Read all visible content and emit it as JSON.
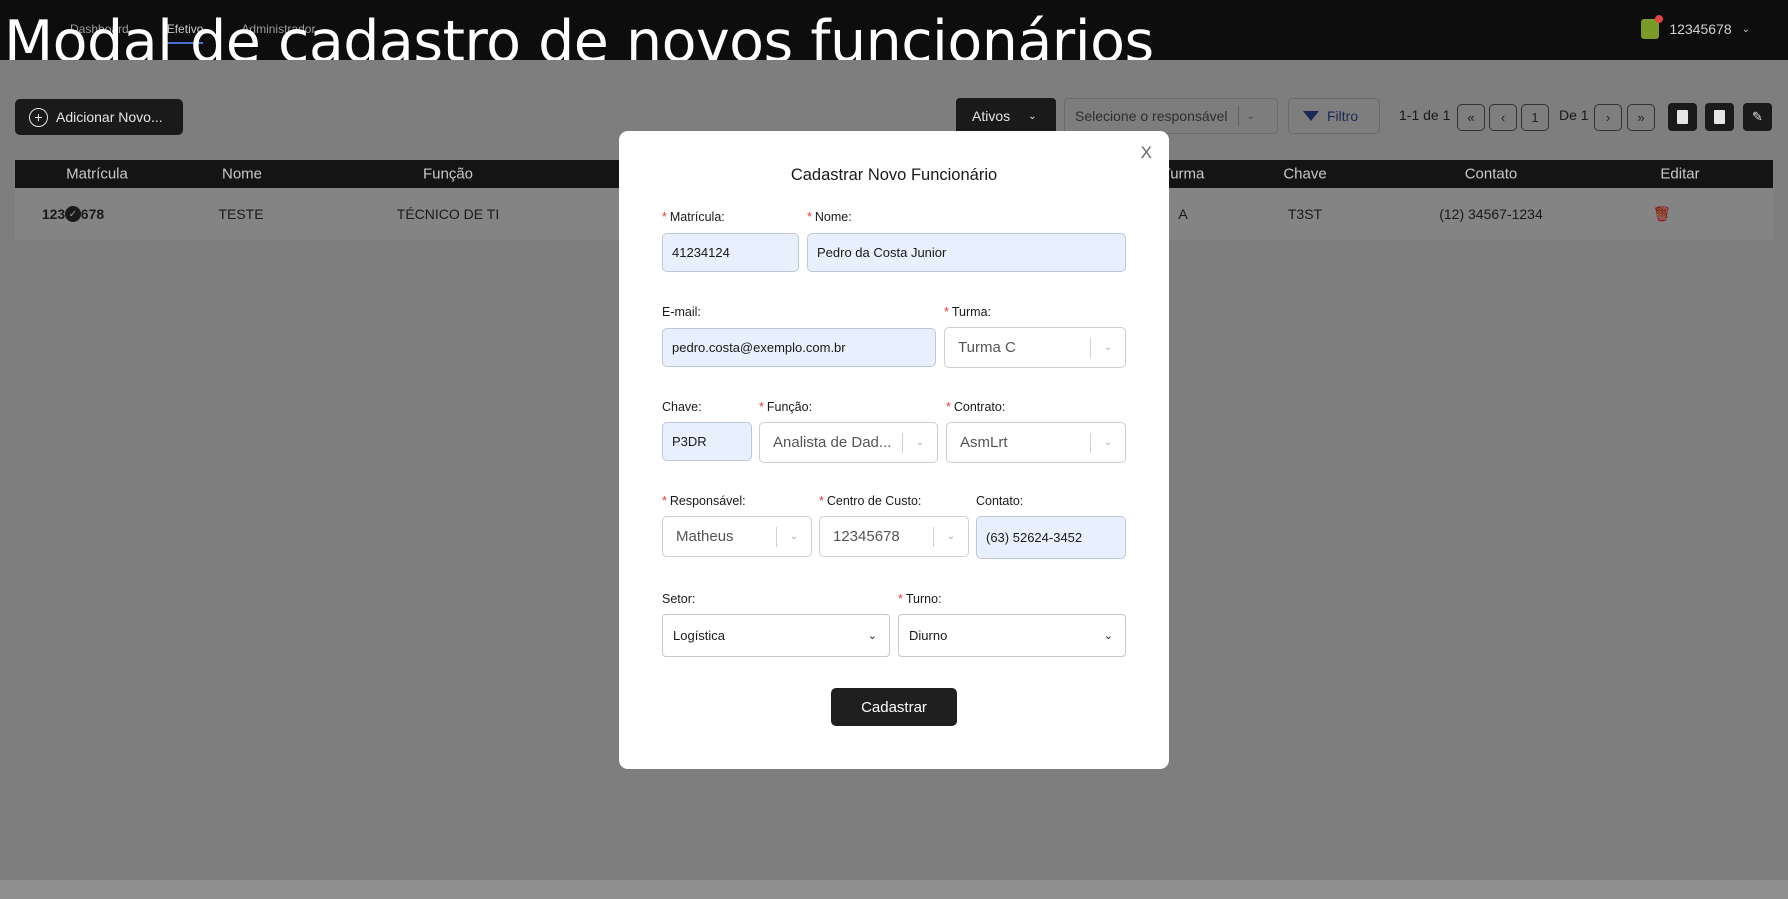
{
  "overlay_title": "Modal de cadastro de novos funcionários",
  "nav": {
    "items": [
      "Dashboard",
      "Efetivo",
      "Administrador"
    ]
  },
  "user": {
    "id": "12345678"
  },
  "toolbar": {
    "add_label": "Adicionar Novo...",
    "status_filter": "Ativos",
    "responsavel_placeholder": "Selecione o responsável",
    "filter_label": "Filtro",
    "range_text": "1-1 de 1",
    "page": "1",
    "page_total": "De 1"
  },
  "table": {
    "headers": {
      "matricula": "Matrícula",
      "nome": "Nome",
      "funcao": "Função",
      "turma": "Turma",
      "chave": "Chave",
      "contato": "Contato",
      "editar": "Editar"
    },
    "row": {
      "matricula": "12345678",
      "nome": "TESTE",
      "funcao": "TÉCNICO DE TI",
      "turma": "A",
      "chave": "T3ST",
      "contato": "(12) 34567-1234"
    }
  },
  "modal": {
    "close": "X",
    "title": "Cadastrar Novo Funcionário",
    "matricula": {
      "label": "Matrícula:",
      "value": "41234124"
    },
    "nome": {
      "label": "Nome:",
      "value": "Pedro da Costa Junior"
    },
    "email": {
      "label": "E-mail:",
      "value": "pedro.costa@exemplo.com.br"
    },
    "turma": {
      "label": "Turma:",
      "value": "Turma C"
    },
    "chave": {
      "label": "Chave:",
      "value": "P3DR"
    },
    "funcao": {
      "label": "Função:",
      "value": "Analista de Dad..."
    },
    "contrato": {
      "label": "Contrato:",
      "value": "AsmLrt"
    },
    "responsavel": {
      "label": "Responsável:",
      "value": "Matheus"
    },
    "centro_custo": {
      "label": "Centro de Custo:",
      "value": "12345678"
    },
    "contato": {
      "label": "Contato:",
      "value": "(63) 52624-3452"
    },
    "setor": {
      "label": "Setor:",
      "value": "Logística"
    },
    "turno": {
      "label": "Turno:",
      "value": "Diurno"
    },
    "submit_label": "Cadastrar"
  },
  "colors": {
    "required_star": "#e0393d",
    "input_bg": "#e8effd",
    "dark": "#1a1a1a"
  }
}
